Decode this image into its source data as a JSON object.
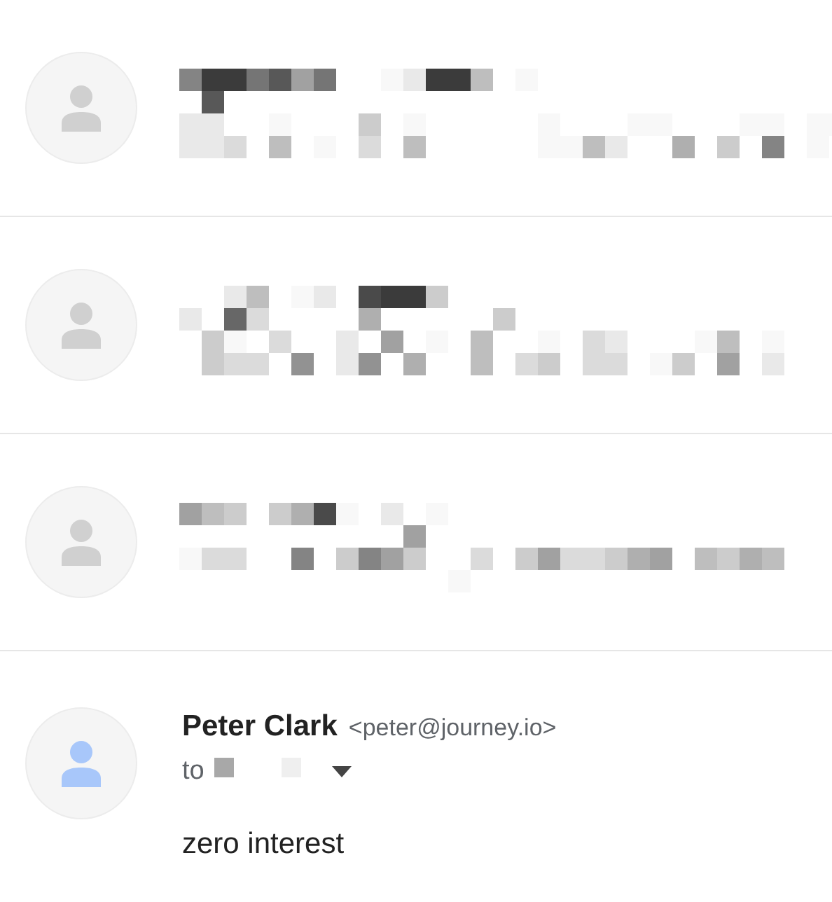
{
  "messages": [
    {
      "kind": "redacted"
    },
    {
      "kind": "redacted"
    },
    {
      "kind": "redacted"
    },
    {
      "kind": "open",
      "sender": "Peter Clark",
      "email": "<peter@journey.io>",
      "to_label": "to",
      "body": "zero interest"
    }
  ]
}
